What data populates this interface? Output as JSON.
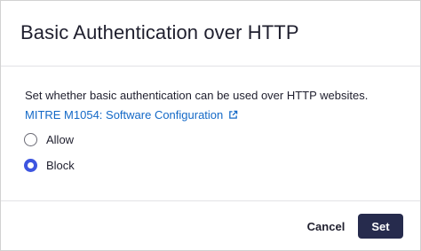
{
  "dialog": {
    "title": "Basic Authentication over HTTP",
    "description": "Set whether basic authentication can be used over HTTP websites.",
    "reference_link": "MITRE M1054: Software Configuration",
    "options": [
      {
        "label": "Allow",
        "selected": false
      },
      {
        "label": "Block",
        "selected": true
      }
    ],
    "cancel_label": "Cancel",
    "set_label": "Set"
  },
  "colors": {
    "link": "#1469c7",
    "radio_selected": "#3d55e0",
    "primary_button": "#262b4d",
    "text": "#1f1f2e",
    "divider": "#e2e2e6"
  },
  "icons": {
    "link_icon": "external-link-icon"
  }
}
